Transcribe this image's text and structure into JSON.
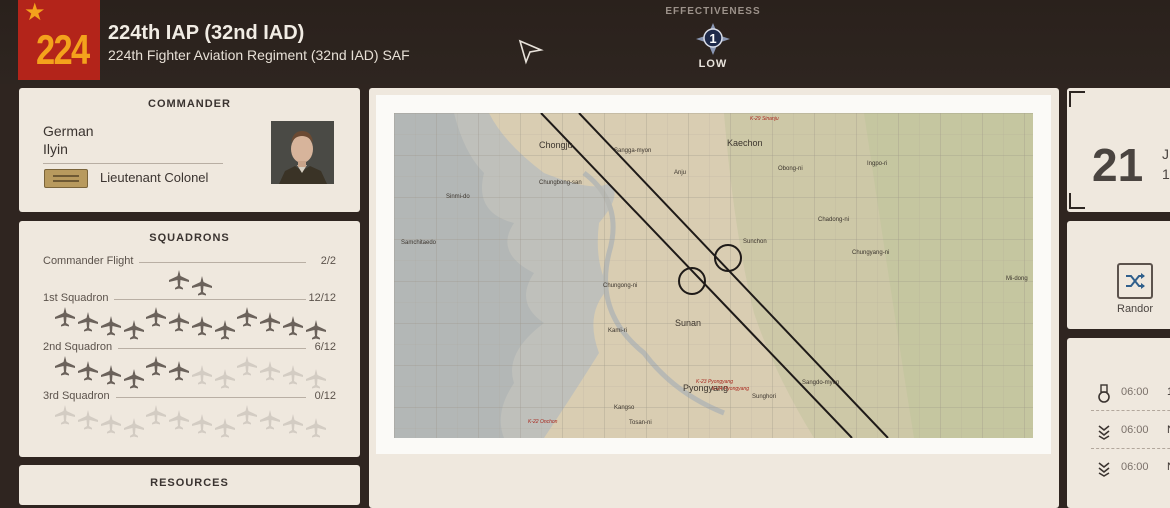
{
  "header": {
    "emblem_number": "224",
    "unit_name": "224th IAP (32nd IAD)",
    "unit_full_name": "224th Fighter Aviation Regiment (32nd IAD) SAF",
    "effectiveness_label": "EFFECTIVENESS",
    "effectiveness_level": "1",
    "effectiveness_value": "LOW"
  },
  "commander": {
    "title": "COMMANDER",
    "first_name": "German",
    "last_name": "Ilyin",
    "rank": "Lieutenant Colonel"
  },
  "squadrons": {
    "title": "SQUADRONS",
    "rows": [
      {
        "name": "Commander Flight",
        "count": "2/2",
        "total": 2,
        "active": 2
      },
      {
        "name": "1st Squadron",
        "count": "12/12",
        "total": 12,
        "active": 12
      },
      {
        "name": "2nd Squadron",
        "count": "6/12",
        "total": 12,
        "active": 6
      },
      {
        "name": "3rd Squadron",
        "count": "0/12",
        "total": 12,
        "active": 0
      }
    ]
  },
  "resources": {
    "title": "RESOURCES"
  },
  "map": {
    "labels": {
      "sinanju": "K-29 Sinanju",
      "chongju": "Chongju",
      "sangga": "Sangga-myon",
      "kaechon": "Kaechon",
      "chungbong": "Chungbong-san",
      "anju": "Anju",
      "obong": "Obong-ni",
      "ingpo": "Ingpo-ri",
      "sinmi": "Sinmi-do",
      "chadong": "Chadong-ni",
      "samchitaedo": "Samchitaedo",
      "sunchon": "Sunchon",
      "chungyang": "Chungyang-ni",
      "midong": "Mi-dong",
      "chungong": "Chungong-ni",
      "kamiri": "Kami-ri",
      "sunan": "Sunan",
      "k23": "K-23 Pyongyang",
      "pyongyang": "Pyongyang",
      "k24": "K-24 Pyongyang",
      "sangdo": "Sangdo-myon",
      "sunghori": "Sunghori",
      "kangso": "Kangso",
      "k22": "K-22 Onchon",
      "tosan": "Tosan-ni"
    }
  },
  "date": {
    "day": "21",
    "line1": "J",
    "line2": "1"
  },
  "random": {
    "label": "Randor"
  },
  "schedule": {
    "rows": [
      {
        "time": "06:00",
        "tail": "1!",
        "icon": "medal-icon"
      },
      {
        "time": "06:00",
        "tail": "N",
        "icon": "chevron-rank-icon"
      },
      {
        "time": "06:00",
        "tail": "N",
        "icon": "chevron-rank-icon"
      }
    ]
  },
  "colors": {
    "accent_red": "#b3241a",
    "accent_gold": "#f4a21c",
    "panel": "#efe8de",
    "background": "#2f2520"
  }
}
